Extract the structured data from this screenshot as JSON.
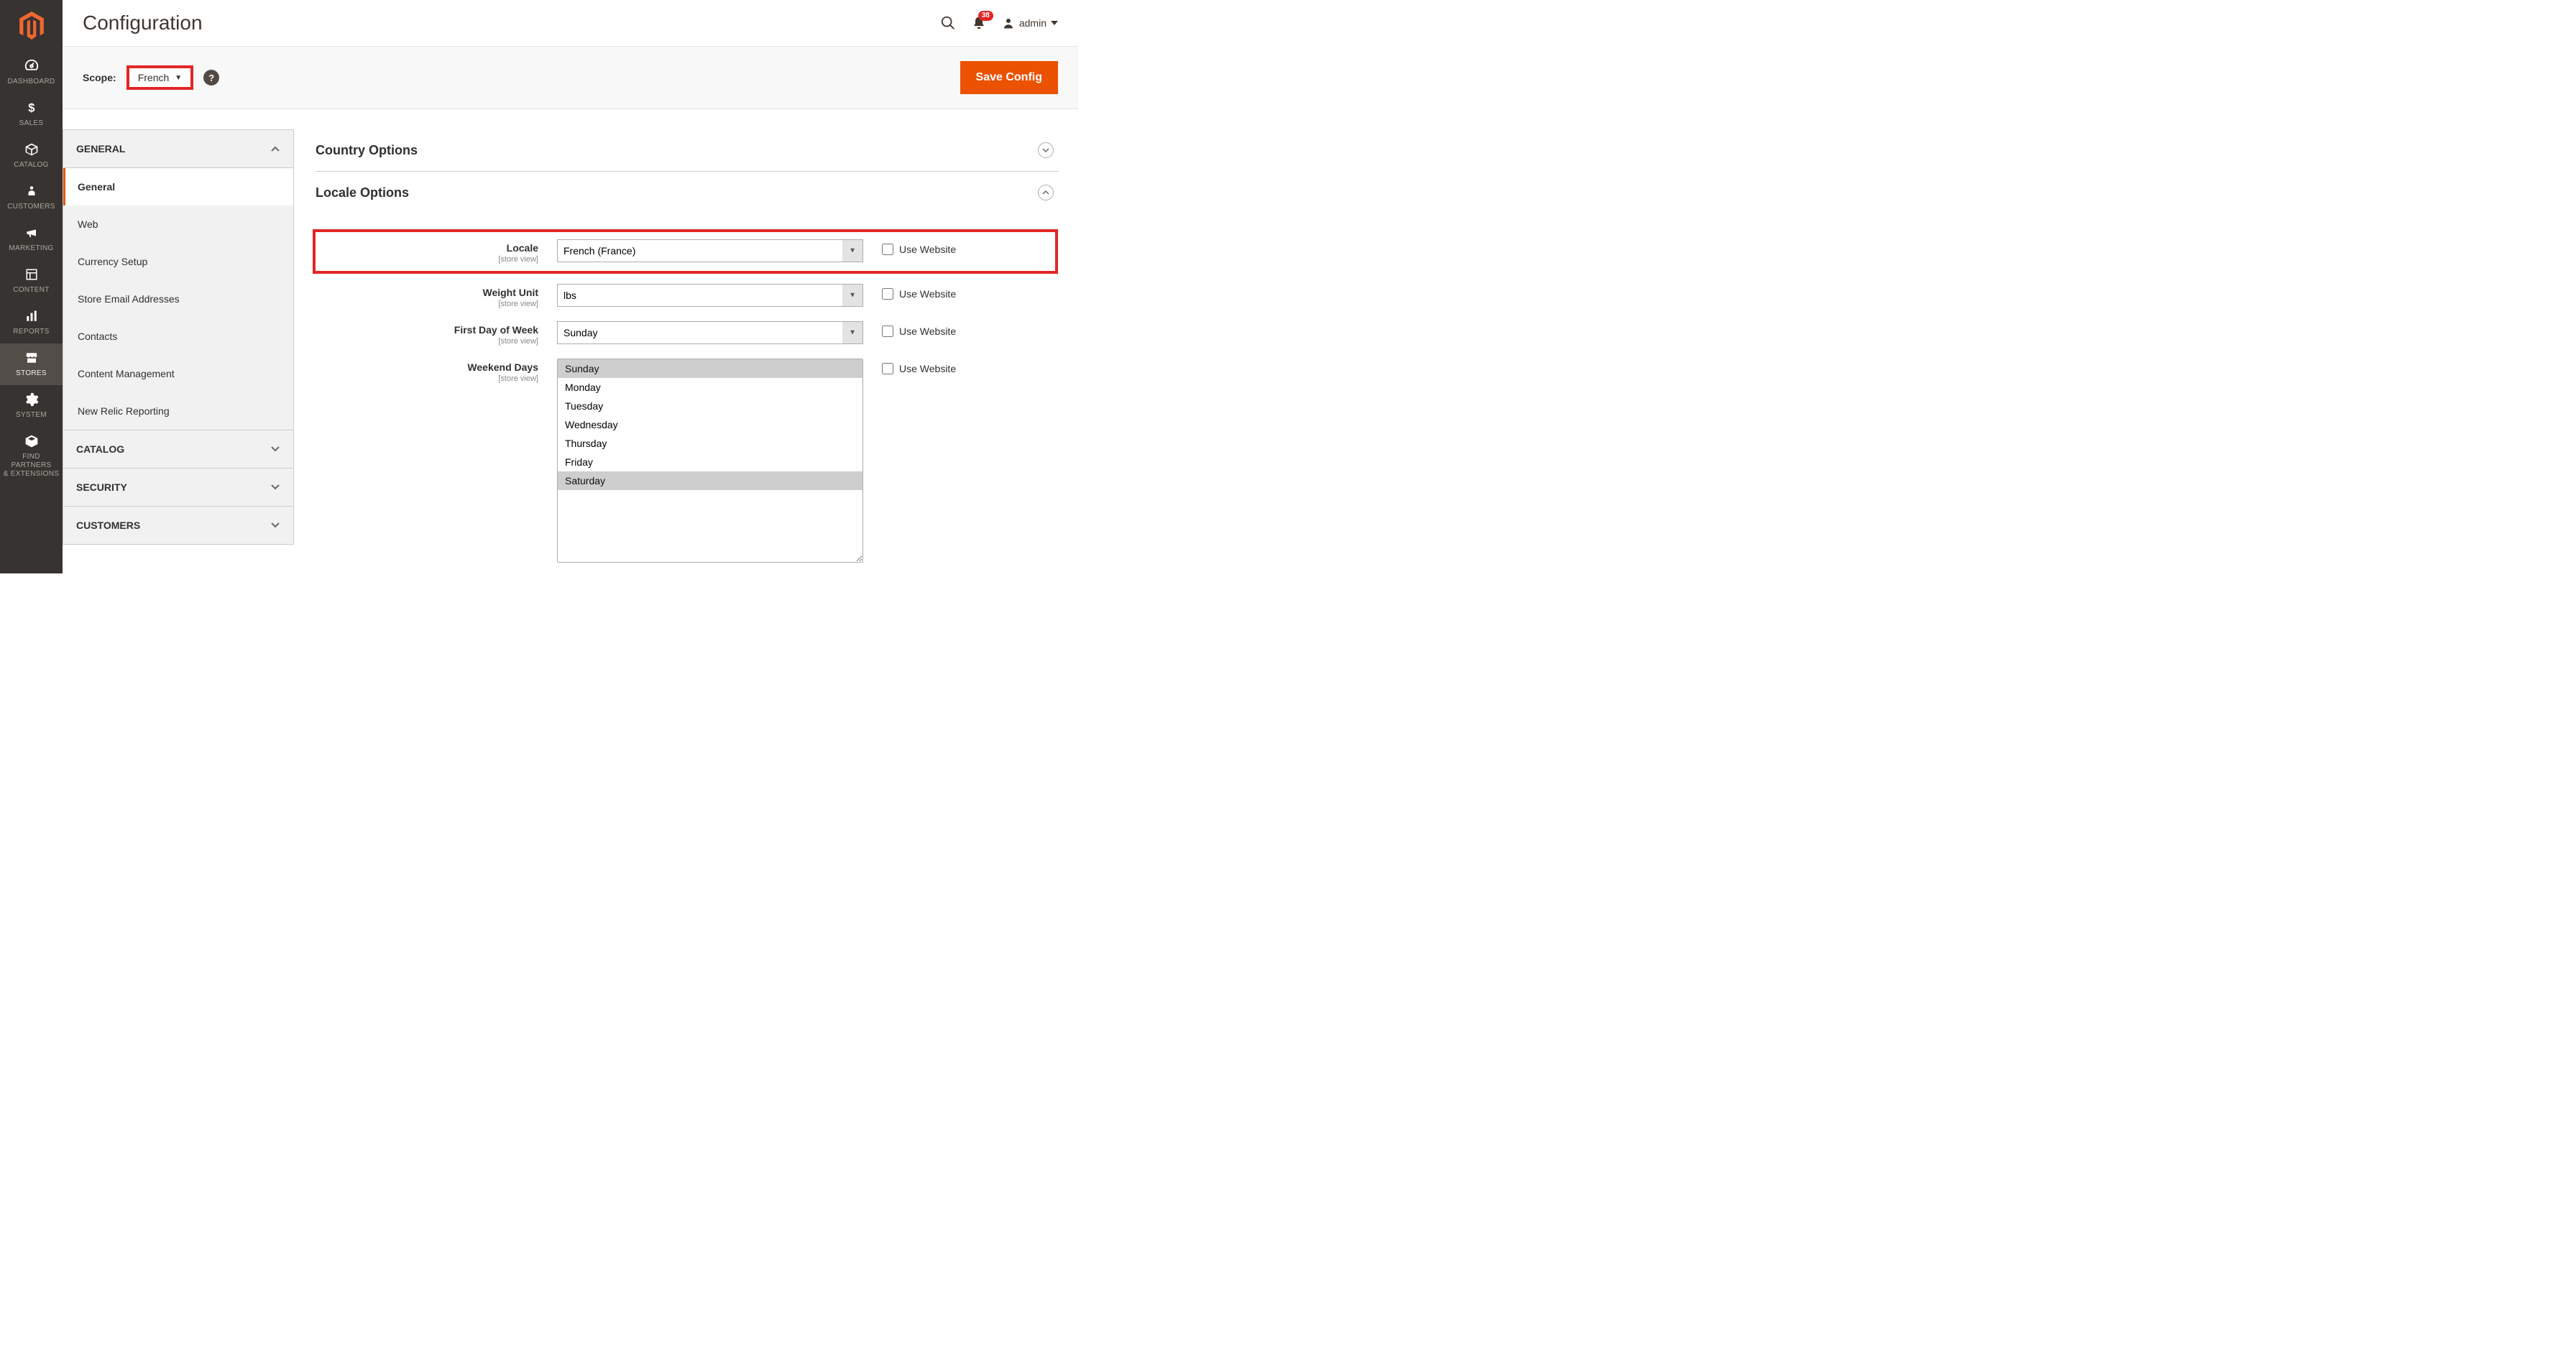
{
  "page_title": "Configuration",
  "user": {
    "name": "admin"
  },
  "notifications": {
    "count": "38"
  },
  "scope": {
    "label": "Scope:",
    "value": "French"
  },
  "save_button": "Save Config",
  "sidebar_items": [
    {
      "label": "DASHBOARD"
    },
    {
      "label": "SALES"
    },
    {
      "label": "CATALOG"
    },
    {
      "label": "CUSTOMERS"
    },
    {
      "label": "MARKETING"
    },
    {
      "label": "CONTENT"
    },
    {
      "label": "REPORTS"
    },
    {
      "label": "STORES"
    },
    {
      "label": "SYSTEM"
    },
    {
      "label": "FIND PARTNERS\n& EXTENSIONS"
    }
  ],
  "accordion": {
    "groups": [
      {
        "label": "GENERAL",
        "open": true,
        "items": [
          "General",
          "Web",
          "Currency Setup",
          "Store Email Addresses",
          "Contacts",
          "Content Management",
          "New Relic Reporting"
        ],
        "active_index": 0
      },
      {
        "label": "CATALOG",
        "open": false
      },
      {
        "label": "SECURITY",
        "open": false
      },
      {
        "label": "CUSTOMERS",
        "open": false
      }
    ]
  },
  "sections": {
    "country": {
      "title": "Country Options"
    },
    "locale": {
      "title": "Locale Options",
      "store_view_hint": "[store view]",
      "use_website_label": "Use Website",
      "fields": [
        {
          "key": "locale",
          "label": "Locale",
          "value": "French (France)",
          "highlight": true
        },
        {
          "key": "weight_unit",
          "label": "Weight Unit",
          "value": "lbs"
        },
        {
          "key": "first_day",
          "label": "First Day of Week",
          "value": "Sunday"
        },
        {
          "key": "weekend",
          "label": "Weekend Days",
          "type": "multi",
          "options": [
            "Sunday",
            "Monday",
            "Tuesday",
            "Wednesday",
            "Thursday",
            "Friday",
            "Saturday"
          ],
          "selected": [
            "Sunday",
            "Saturday"
          ]
        }
      ]
    }
  }
}
